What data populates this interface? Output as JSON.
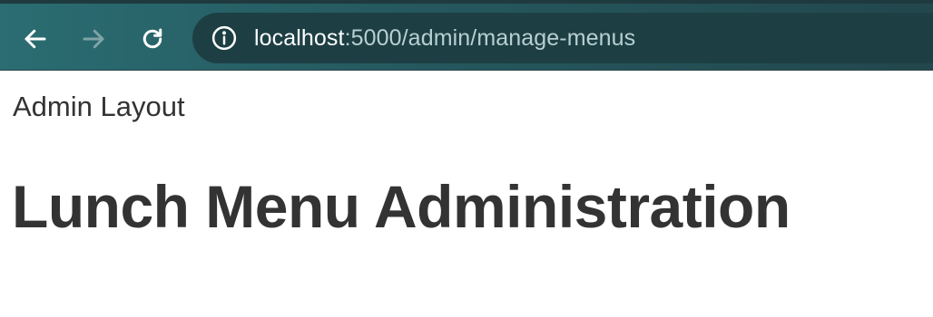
{
  "browser": {
    "url_host": "localhost",
    "url_rest": ":5000/admin/manage-menus",
    "icons": {
      "back": "arrow-left-icon",
      "forward": "arrow-right-icon",
      "reload": "reload-icon",
      "site_info": "info-icon"
    },
    "forward_enabled": false
  },
  "page": {
    "layout_label": "Admin Layout",
    "title": "Lunch Menu Administration"
  },
  "colors": {
    "toolbar": "#255a60",
    "address_bar": "#1d3f44",
    "text": "#333333"
  }
}
